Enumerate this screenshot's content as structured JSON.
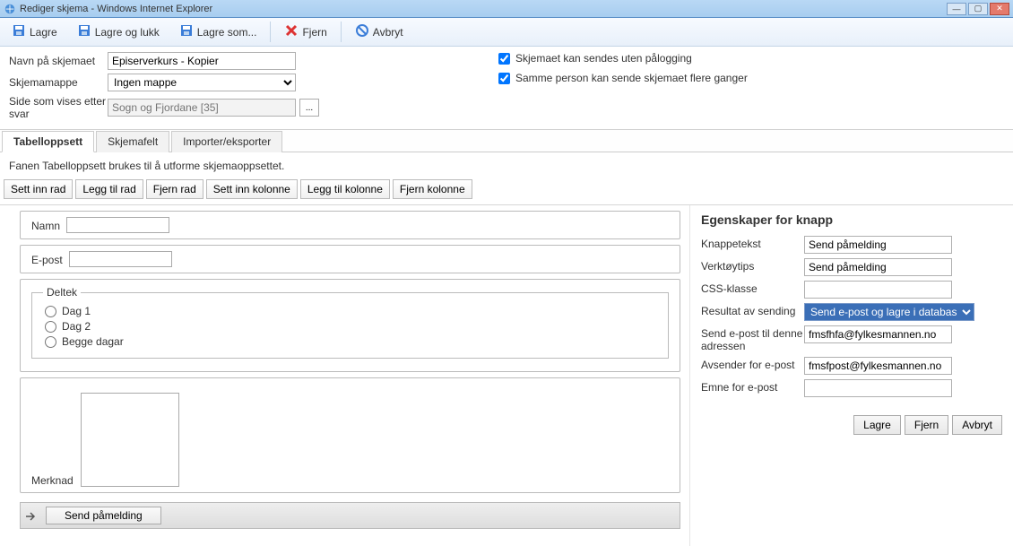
{
  "window": {
    "title": "Rediger skjema - Windows Internet Explorer"
  },
  "toolbar": {
    "save": "Lagre",
    "saveClose": "Lagre og lukk",
    "saveAs": "Lagre som...",
    "remove": "Fjern",
    "cancel": "Avbryt"
  },
  "form": {
    "nameLabel": "Navn på skjemaet",
    "nameValue": "Episerverkurs - Kopier",
    "folderLabel": "Skjemamappe",
    "folderValue": "Ingen mappe",
    "pageLabel": "Side som vises etter svar",
    "pagePlaceholder": "Sogn og Fjordane [35]",
    "chkAnon": "Skjemaet kan sendes uten pålogging",
    "chkRepeat": "Samme person kan sende skjemaet flere ganger"
  },
  "tabs": {
    "layout": "Tabelloppsett",
    "fields": "Skjemafelt",
    "import": "Importer/eksporter"
  },
  "tabDesc": "Fanen Tabelloppsett brukes til å utforme skjemaoppsettet.",
  "buttons": {
    "insertRow": "Sett inn rad",
    "addRow": "Legg til rad",
    "removeRow": "Fjern rad",
    "insertCol": "Sett inn kolonne",
    "addCol": "Legg til kolonne",
    "removeCol": "Fjern kolonne"
  },
  "preview": {
    "nameLabel": "Namn",
    "emailLabel": "E-post",
    "fieldsetLegend": "Deltek",
    "opt1": "Dag 1",
    "opt2": "Dag 2",
    "opt3": "Begge dagar",
    "notesLabel": "Merknad",
    "submitLabel": "Send påmelding"
  },
  "props": {
    "heading": "Egenskaper for knapp",
    "btnTextLabel": "Knappetekst",
    "btnTextValue": "Send påmelding",
    "tooltipLabel": "Verktøytips",
    "tooltipValue": "Send påmelding",
    "cssLabel": "CSS-klasse",
    "cssValue": "",
    "resultLabel": "Resultat av sending",
    "resultValue": "Send e-post og lagre i database",
    "emailToLabel": "Send e-post til denne adressen",
    "emailToValue": "fmsfhfa@fylkesmannen.no",
    "senderLabel": "Avsender for e-post",
    "senderValue": "fmsfpost@fylkesmannen.no",
    "subjectLabel": "Emne for e-post",
    "subjectValue": "",
    "save": "Lagre",
    "remove": "Fjern",
    "cancel": "Avbryt"
  }
}
